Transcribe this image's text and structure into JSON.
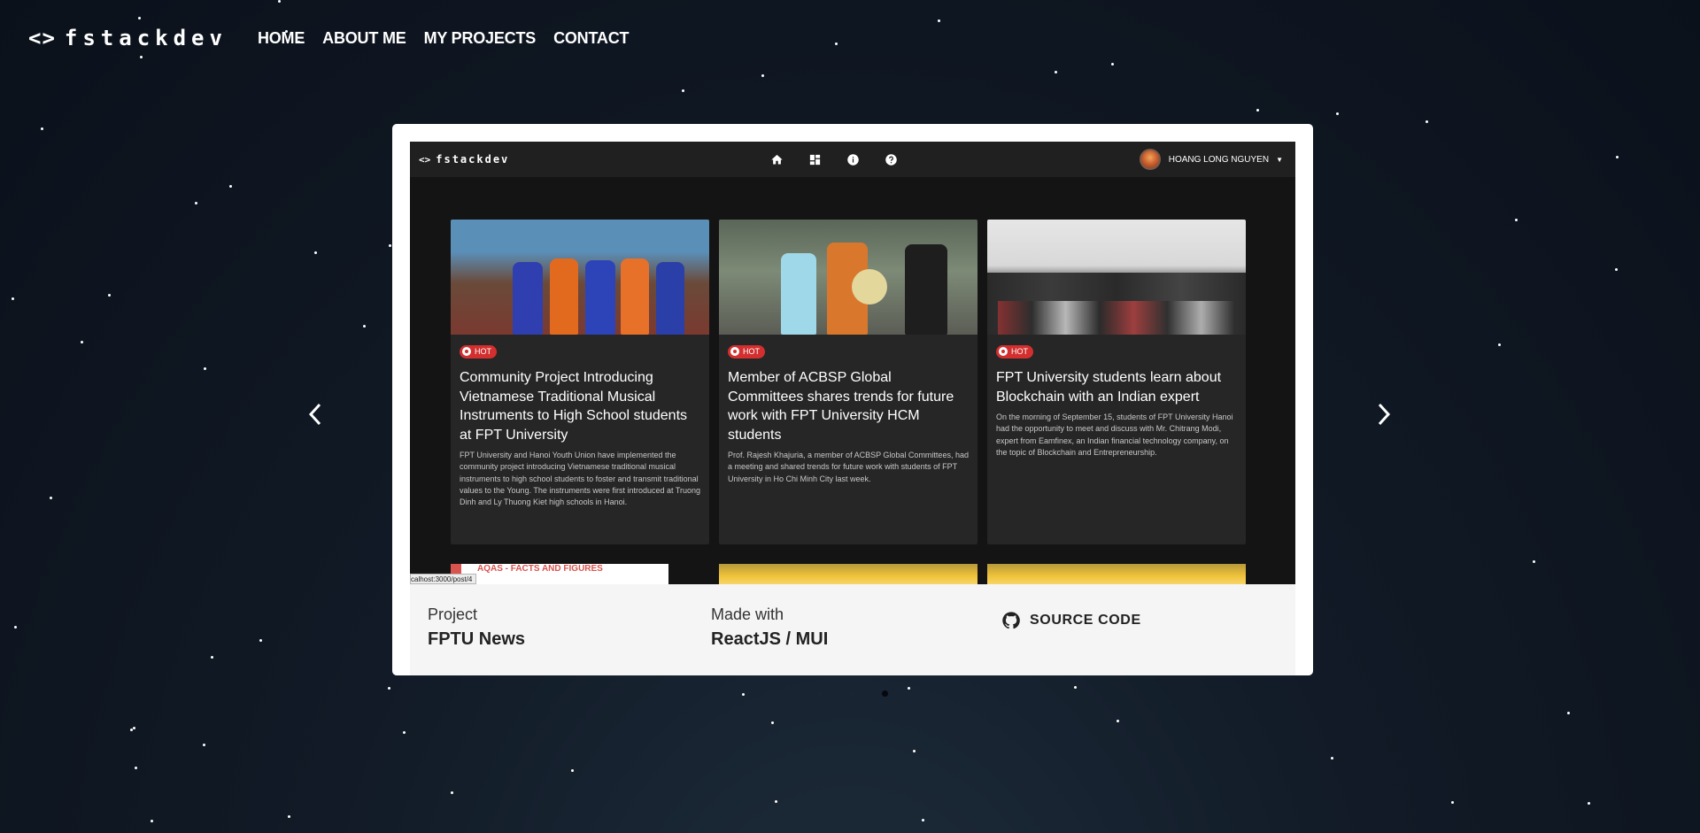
{
  "header": {
    "logo_icon": "<>",
    "logo_text": "fstackdev",
    "nav": [
      "HOME",
      "ABOUT ME",
      "MY PROJECTS",
      "CONTACT"
    ]
  },
  "carousel": {
    "prev_icon": "chevron-left-icon",
    "next_icon": "chevron-right-icon",
    "dots_total": 3,
    "active_dot": 3
  },
  "screenshot": {
    "app_logo_icon": "<>",
    "app_logo_text": "fstackdev",
    "toolbar_icons": [
      "home-icon",
      "dashboard-icon",
      "info-icon",
      "help-icon"
    ],
    "user_name": "HOANG LONG NGUYEN",
    "posts": [
      {
        "badge": "HOT",
        "title": "Community Project Introducing Vietnamese Traditional Musical Instruments to High School students at FPT University",
        "description": "FPT University and Hanoi Youth Union have implemented the community project introducing Vietnamese traditional musical instruments to high school students to foster and transmit traditional values to the Young. The instruments were first introduced at Truong Dinh and Ly Thuong Kiet high schools in Hanoi."
      },
      {
        "badge": "HOT",
        "title": "Member of ACBSP Global Committees shares trends for future work with FPT University HCM students",
        "description": "Prof. Rajesh Khajuria, a member of ACBSP Global Committees, had a meeting and shared trends for future work with students of FPT University in Ho Chi Minh City last week."
      },
      {
        "badge": "HOT",
        "title": "FPT University students learn about Blockchain with an Indian expert",
        "description": "On the morning of September 15, students of FPT University Hanoi had the opportunity to meet and discuss with Mr. Chitrang Modi, expert from Eamfinex, an Indian financial technology company, on the topic of Blockchain and Entrepreneurship."
      }
    ],
    "next_row_thumb_text": "AQAS - FACTS AND FIGURES",
    "status_url": "calhost:3000/post/4"
  },
  "project": {
    "project_label": "Project",
    "project_name": "FPTU News",
    "made_with_label": "Made with",
    "made_with_value": "ReactJS / MUI",
    "source_label": "SOURCE CODE",
    "source_icon": "github-icon"
  },
  "colors": {
    "hot_badge": "#d32f2f",
    "card_bg": "#ffffff",
    "info_bg": "#f5f5f5",
    "page_bg": "#0f1722"
  }
}
